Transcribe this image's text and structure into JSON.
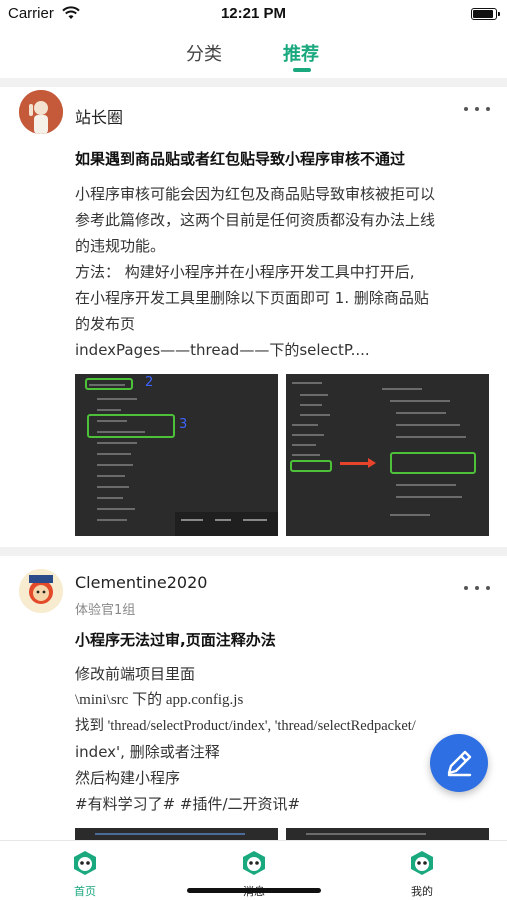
{
  "status_bar": {
    "carrier": "Carrier",
    "time": "12:21 PM"
  },
  "top_tabs": [
    {
      "label": "分类"
    },
    {
      "label": "推荐"
    }
  ],
  "posts": [
    {
      "author": "站长圈",
      "title": "如果遇到商品贴或者红包贴导致小程序审核不通过",
      "body_lines": [
        "小程序审核可能会因为红包及商品贴导致审核被拒可以",
        "参考此篇修改，这两个目前是任何资质都没有办法上线",
        "的违规功能。",
        "方法： 构建好小程序并在小程序开发工具中打开后,",
        "在小程序开发工具里删除以下页面即可 1. 删除商品贴",
        "的发布页",
        "indexPages——thread——下的selectP...."
      ],
      "image_labels": [
        "2",
        "3"
      ]
    },
    {
      "author": "Clementine2020",
      "author_group": "体验官1组",
      "title": "小程序无法过审,页面注释办法",
      "body_lines": [
        "修改前端项目里面",
        "\\mini\\src 下的 app.config.js",
        "找到 'thread/selectProduct/index', 'thread/selectRedpacket/",
        "index', 删除或者注释",
        "然后构建小程序"
      ],
      "tags_line": "#有料学习了#  #插件/二开资讯#"
    }
  ],
  "bottom_nav": [
    {
      "label": "首页",
      "icon": "panda-icon",
      "active": true
    },
    {
      "label": "消息",
      "icon": "panda-icon",
      "active": false
    },
    {
      "label": "我的",
      "icon": "panda-icon",
      "active": false
    }
  ],
  "colors": {
    "accent": "#1aa87f",
    "fab": "#2e6fe3",
    "divider": "#f1f1f1"
  }
}
